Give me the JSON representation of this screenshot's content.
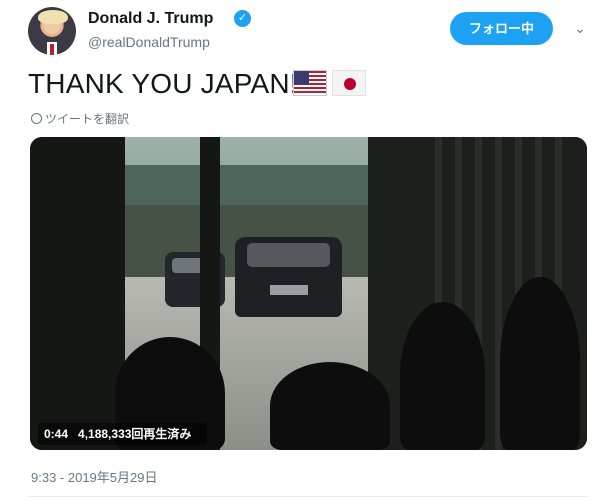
{
  "author": {
    "name": "Donald J. Trump",
    "handle": "@realDonaldTrump",
    "verified_icon": "verified-badge-icon"
  },
  "actions": {
    "follow_label": "フォロー中",
    "menu_icon": "chevron-down-icon"
  },
  "tweet": {
    "text": "THANK YOU JAPAN!",
    "emoji": [
      "flag-us-icon",
      "flag-jp-icon"
    ],
    "translate_label": "ツイートを翻訳"
  },
  "video": {
    "duration": "0:44",
    "views": "4,188,333回再生済み"
  },
  "meta": {
    "timestamp": "9:33 - 2019年5月29日"
  },
  "colors": {
    "accent": "#1da1f2",
    "secondary_text": "#657786"
  }
}
